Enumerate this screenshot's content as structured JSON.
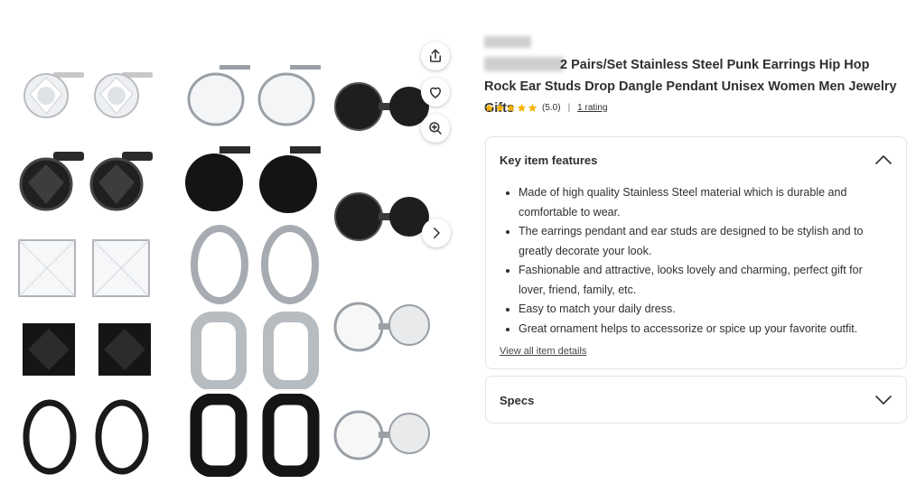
{
  "product": {
    "title": "2 Pairs/Set Stainless Steel Punk Earrings Hip Hop Rock Ear Studs Drop Dangle Pendant Unisex Women Men Jewelry Gifts",
    "rating_value": "(5.0)",
    "rating_separator": "|",
    "rating_count_label": "1 rating",
    "stars": 5,
    "star_color": "#f4b400"
  },
  "gallery": {
    "icons": [
      "share-icon",
      "heart-icon",
      "zoom-in-icon",
      "chevron-right-icon"
    ]
  },
  "features_panel": {
    "title": "Key item features",
    "items": [
      "Made of high quality Stainless Steel material which is durable and comfortable to wear.",
      "The earrings pendant and ear studs are designed to be stylish and to greatly decorate your look.",
      "Fashionable and attractive, looks lovely and charming, perfect gift for lover, friend, family, etc.",
      "Easy to match your daily dress.",
      "Great ornament helps to accessorize or spice up your favorite outfit."
    ],
    "view_all_label": "View all item details"
  },
  "specs_panel": {
    "title": "Specs"
  },
  "colors": {
    "text": "#2e2f32",
    "border": "#e3e4e5"
  }
}
